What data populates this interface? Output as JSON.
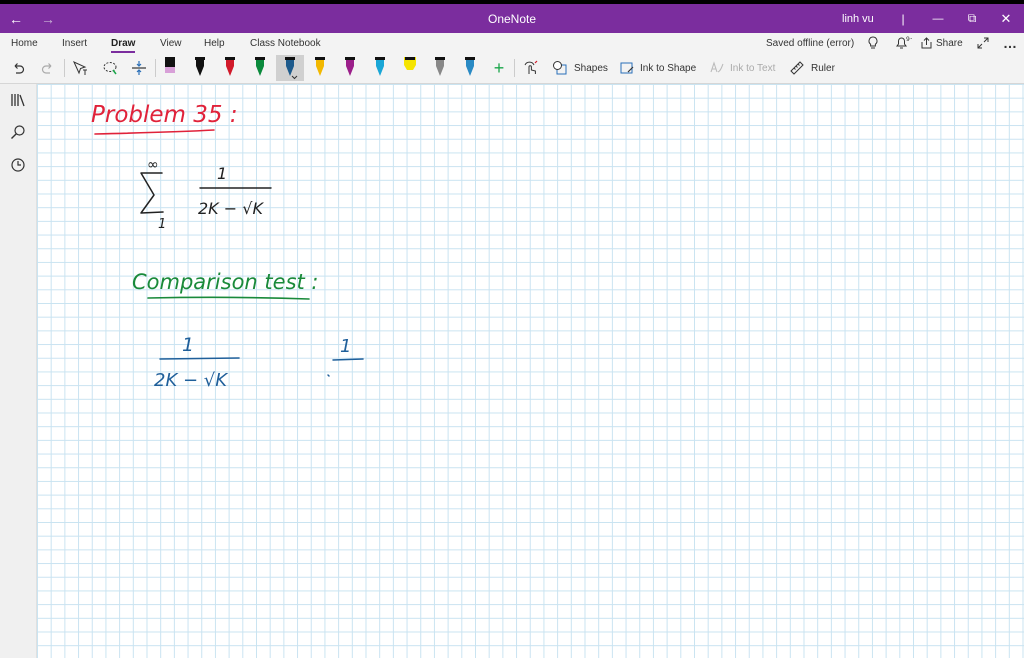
{
  "window": {
    "title": "OneNote",
    "user": "linh vu",
    "back_glyph": "←",
    "forward_glyph": "→",
    "minimize_glyph": "—",
    "restore_glyph": "⧉",
    "close_glyph": "✕"
  },
  "tabs": [
    {
      "label": "Home"
    },
    {
      "label": "Insert"
    },
    {
      "label": "Draw"
    },
    {
      "label": "View"
    },
    {
      "label": "Help"
    },
    {
      "label": "Class Notebook"
    }
  ],
  "active_tab": "Draw",
  "status": {
    "saved": "Saved offline (error)",
    "share": "Share",
    "more": "…"
  },
  "ribbon": {
    "shapes": "Shapes",
    "ink_to_shape": "Ink to Shape",
    "ink_to_text": "Ink to Text",
    "ruler": "Ruler",
    "add_pen": "+"
  },
  "pens": [
    {
      "color": "#d8a0d8",
      "type": "marker"
    },
    {
      "color": "#111111",
      "type": "pen"
    },
    {
      "color": "#d11a2a",
      "type": "pen"
    },
    {
      "color": "#0b8a3c",
      "type": "pen"
    },
    {
      "color": "#1d5a8c",
      "type": "pen",
      "selected": true
    },
    {
      "color": "#f2b800",
      "type": "pen"
    },
    {
      "color": "#9b1f8a",
      "type": "pen"
    },
    {
      "color": "#1aa6d6",
      "type": "pen"
    },
    {
      "color": "#f5e400",
      "type": "highlighter"
    },
    {
      "color": "#888888",
      "type": "pen"
    },
    {
      "color": "#2a8ac4",
      "type": "pen"
    }
  ],
  "ink": {
    "heading": "Problem 35 :",
    "sum_upper": "∞",
    "sum_lower": "1",
    "sum_numerator": "1",
    "sum_denominator": "2K − √K",
    "method": "Comparison test :",
    "frac_numerator": "1",
    "frac_denominator": "2K − √K",
    "frac2_numerator": "1"
  },
  "colors": {
    "title_bar": "#7b2d9e",
    "ink_red": "#e0223a",
    "ink_green": "#1a8a3a",
    "ink_blue": "#1f5f9a",
    "grid": "#c9e3f1"
  }
}
